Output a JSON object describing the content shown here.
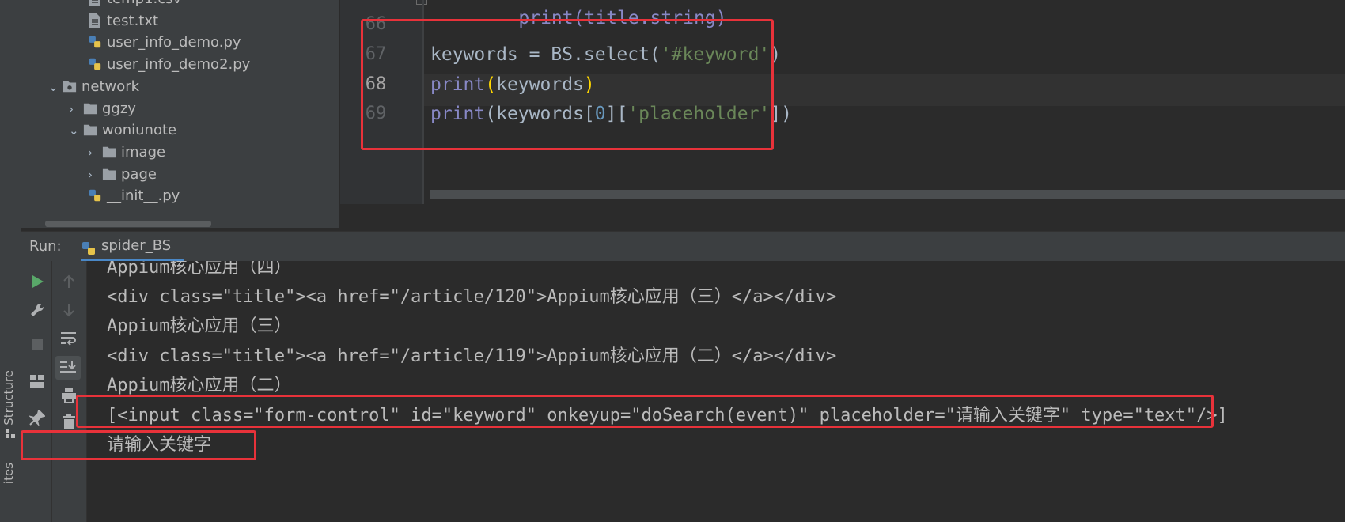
{
  "left_strip": {
    "structure_label": "Structure",
    "favorites_label": "ites"
  },
  "project_tree": [
    {
      "type": "file-csv",
      "indent": 1,
      "label": "temp1.csv"
    },
    {
      "type": "file-txt",
      "indent": 1,
      "label": "test.txt"
    },
    {
      "type": "file-py",
      "indent": 1,
      "label": "user_info_demo.py"
    },
    {
      "type": "file-py",
      "indent": 1,
      "label": "user_info_demo2.py"
    },
    {
      "type": "package",
      "indent": 0,
      "expanded": true,
      "label": "network"
    },
    {
      "type": "folder",
      "indent": 1,
      "expanded": false,
      "label": "ggzy"
    },
    {
      "type": "folder",
      "indent": 1,
      "expanded": true,
      "label": "woniunote"
    },
    {
      "type": "folder",
      "indent": 2,
      "expanded": false,
      "label": "image"
    },
    {
      "type": "folder",
      "indent": 2,
      "expanded": false,
      "label": "page"
    },
    {
      "type": "file-py",
      "indent": 1,
      "label": "__init__.py"
    }
  ],
  "editor": {
    "line_numbers": [
      "66",
      "67",
      "68",
      "69"
    ],
    "current_line": "68",
    "partial_top_line": "print(title.string)",
    "lines": {
      "l67": {
        "var": "keywords",
        "op": " = ",
        "obj": "BS.select(",
        "arg": "'#keyword'",
        "close": ")"
      },
      "l68": {
        "fn": "print",
        "open": "(",
        "arg": "keywords",
        "close": ")"
      },
      "l69": {
        "fn": "print",
        "pre": "(keywords[",
        "idx": "0",
        "mid": "][",
        "key": "'placeholder'",
        "post": "])"
      }
    }
  },
  "run_panel": {
    "label": "Run:",
    "tab_label": "spider_BS",
    "output_lines": [
      "Appium核心应用（四）",
      "<div class=\"title\"><a href=\"/article/120\">Appium核心应用（三）</a></div>",
      "Appium核心应用（三）",
      "<div class=\"title\"><a href=\"/article/119\">Appium核心应用（二）</a></div>",
      "Appium核心应用（二）",
      "[<input class=\"form-control\" id=\"keyword\" onkeyup=\"doSearch(event)\" placeholder=\"请输入关键字\" type=\"text\"/>]",
      "请输入关键字"
    ]
  },
  "colors": {
    "highlight_box": "#e8323a",
    "keyword": "#8888c6",
    "string": "#6a8759",
    "number": "#6897bb"
  }
}
